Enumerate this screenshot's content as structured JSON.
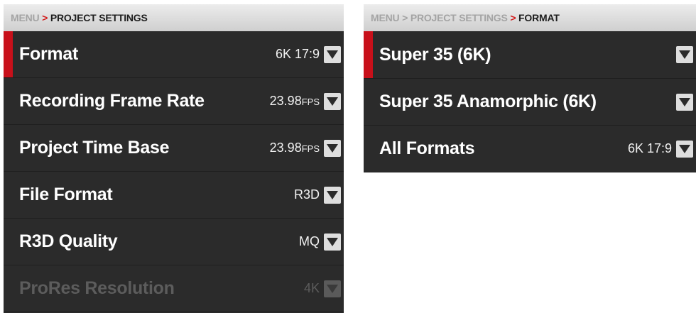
{
  "left": {
    "breadcrumb": {
      "root": "MENU",
      "separator": ">",
      "current": "PROJECT SETTINGS"
    },
    "rows": [
      {
        "label": "Format",
        "value": "6K 17:9",
        "unit": ""
      },
      {
        "label": "Recording Frame Rate",
        "value": "23.98",
        "unit": "FPS"
      },
      {
        "label": "Project Time Base",
        "value": "23.98",
        "unit": "FPS"
      },
      {
        "label": "File Format",
        "value": "R3D",
        "unit": ""
      },
      {
        "label": "R3D Quality",
        "value": "MQ",
        "unit": ""
      },
      {
        "label": "ProRes Resolution",
        "value": "4K",
        "unit": ""
      }
    ]
  },
  "right": {
    "breadcrumb": {
      "root": "MENU",
      "separator1": ">",
      "middle": "PROJECT SETTINGS",
      "separator2": ">",
      "current": "FORMAT"
    },
    "rows": [
      {
        "label": "Super 35 (6K)",
        "value": ""
      },
      {
        "label": "Super 35 Anamorphic (6K)",
        "value": ""
      },
      {
        "label": "All Formats",
        "value": "6K 17:9"
      }
    ]
  },
  "colors": {
    "accent_red": "#c8101a",
    "panel_bg": "#2b2b2b",
    "breadcrumb_separator": "#d21c1c"
  },
  "icons": {
    "dropdown": "chevron-down-icon"
  }
}
